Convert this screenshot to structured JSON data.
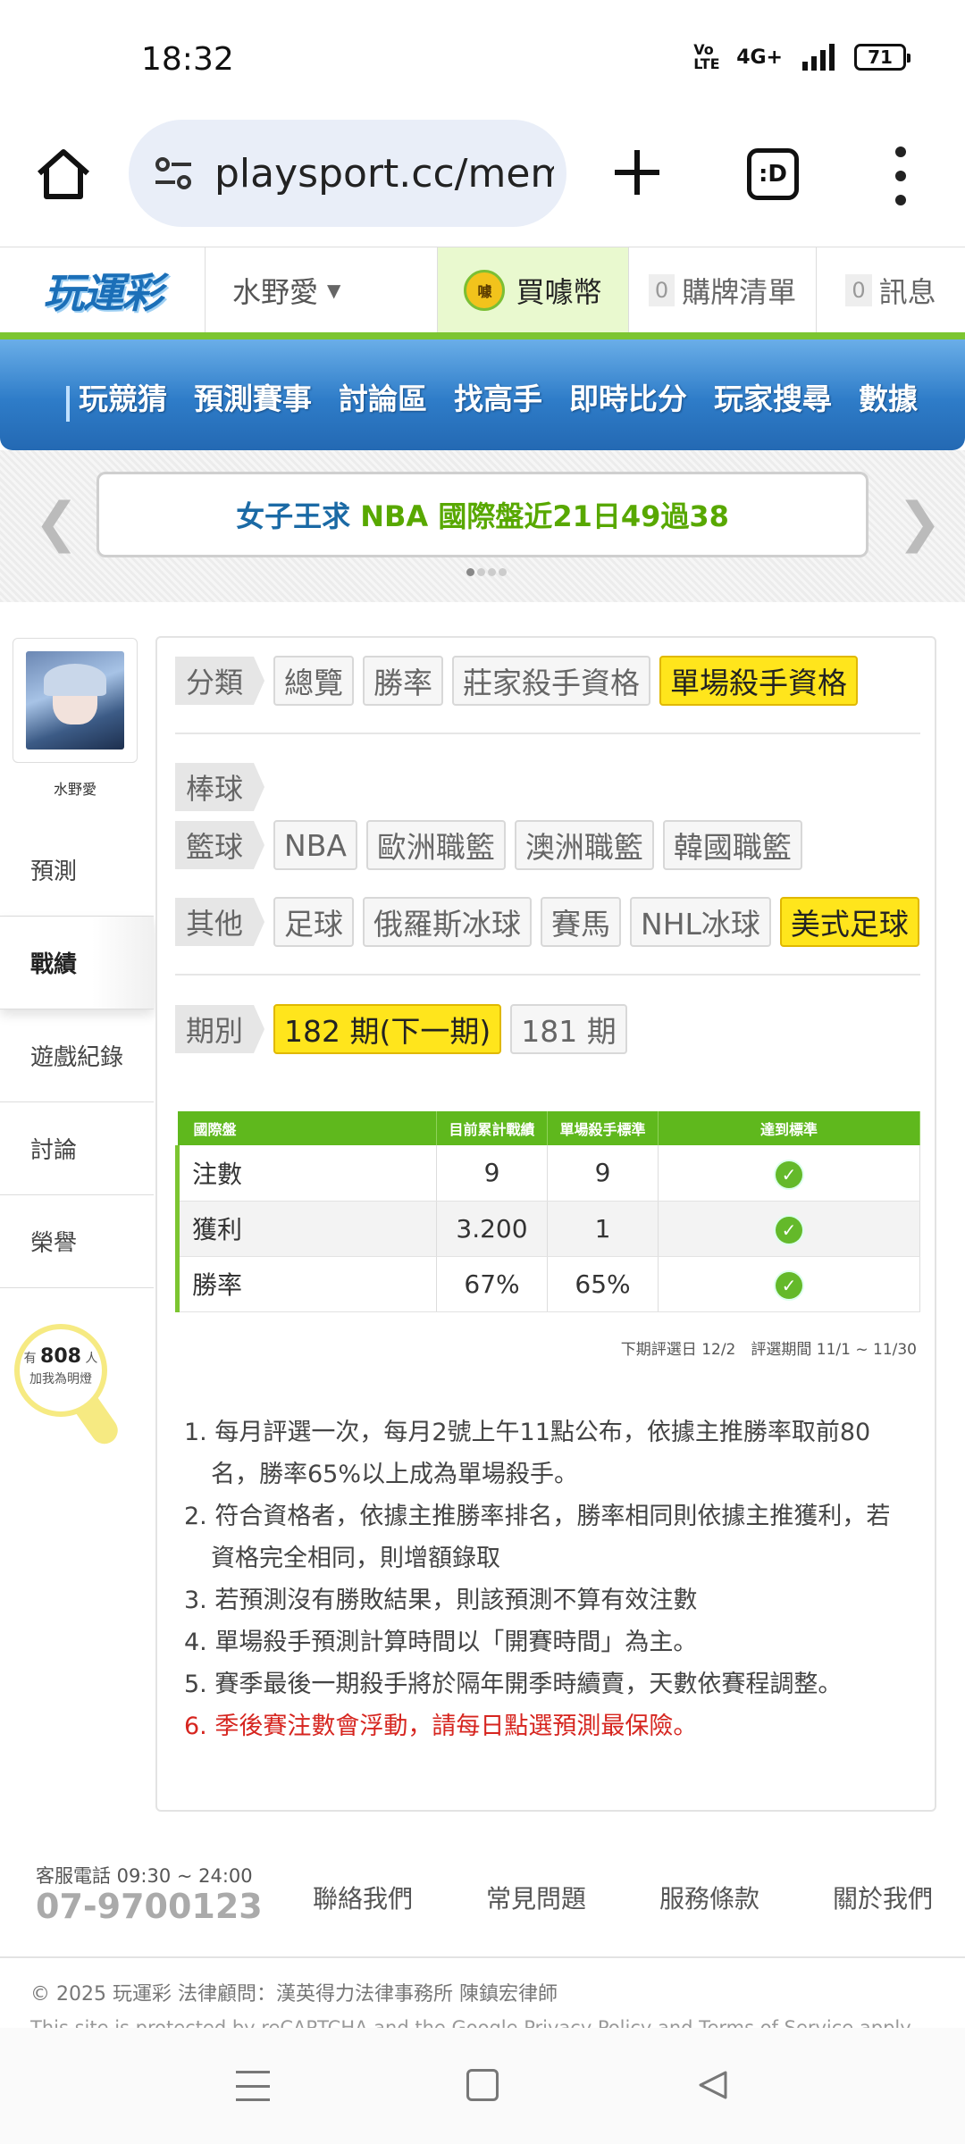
{
  "status_bar": {
    "time": "18:32",
    "volte": "Vo LTE",
    "network": "4G+",
    "battery": "71"
  },
  "browser": {
    "url": "playsport.cc/mem",
    "tabs_label": ":D"
  },
  "site_header": {
    "logo": "玩運彩",
    "user_name": "水野愛",
    "buy_coins": "買噱幣",
    "coin_icon_text": "噱",
    "cart_count": "0",
    "cart_label": "購牌清單",
    "msg_count": "0",
    "msg_label": "訊息"
  },
  "main_nav": [
    "玩競猜",
    "預測賽事",
    "討論區",
    "找高手",
    "即時比分",
    "玩家搜尋",
    "數據"
  ],
  "banner": {
    "part1": "女子王求",
    "part2": "NBA 國際盤近21日49過38"
  },
  "profile": {
    "name": "水野愛",
    "fans_prefix": "有",
    "fans_count": "808",
    "fans_suffix": "人",
    "fans_line2": "加我為明燈"
  },
  "side_nav": [
    "預測",
    "戰績",
    "遊戲紀錄",
    "討論",
    "榮譽"
  ],
  "filters": {
    "category_label": "分類",
    "category_chips": [
      "總覽",
      "勝率",
      "莊家殺手資格",
      "單場殺手資格"
    ],
    "baseball_label": "棒球",
    "basketball_label": "籃球",
    "basketball_chips": [
      "NBA",
      "歐洲職籃",
      "澳洲職籃",
      "韓國職籃"
    ],
    "other_label": "其他",
    "other_chips": [
      "足球",
      "俄羅斯冰球",
      "賽馬",
      "NHL冰球",
      "美式足球"
    ],
    "period_label": "期別",
    "period_chips": [
      "182 期(下一期)",
      "181 期"
    ]
  },
  "table": {
    "headers": [
      "國際盤",
      "目前累計戰績",
      "單場殺手標準",
      "達到標準"
    ],
    "rows": [
      {
        "label": "注數",
        "current": "9",
        "standard": "9",
        "met": true
      },
      {
        "label": "獲利",
        "current": "3.200",
        "standard": "1",
        "met": true
      },
      {
        "label": "勝率",
        "current": "67%",
        "standard": "65%",
        "met": true
      }
    ],
    "note": "下期評選日 12/2　評選期間 11/1 ~ 11/30"
  },
  "rules": [
    "1. 每月評選一次，每月2號上午11點公布，依據主推勝率取前80名，勝率65%以上成為單場殺手。",
    "2. 符合資格者，依據主推勝率排名，勝率相同則依據主推獲利，若資格完全相同，則增額錄取",
    "3. 若預測沒有勝敗結果，則該預測不算有效注數",
    "4. 單場殺手預測計算時間以「開賽時間」為主。",
    "5. 賽季最後一期殺手將於隔年開季時續賣，天數依賽程調整。",
    "6. 季後賽注數會浮動，請每日點選預測最保險。"
  ],
  "footer": {
    "phone_label": "客服電話 09:30 ~ 24:00",
    "phone": "07-9700123",
    "links": [
      "聯絡我們",
      "常見問題",
      "服務條款",
      "關於我們"
    ],
    "copyright": "© 2025 玩運彩 法律顧問：漢英得力法律事務所 陳鎮宏律師",
    "recaptcha": "This site is protected by reCAPTCHA and the Google Privacy Policy and Terms of Service apply."
  },
  "colors": {
    "accent_green": "#5fb81d",
    "nav_blue": "#2e7cc8",
    "selected_yellow": "#ffe51c",
    "warning_red": "#d6251f"
  }
}
